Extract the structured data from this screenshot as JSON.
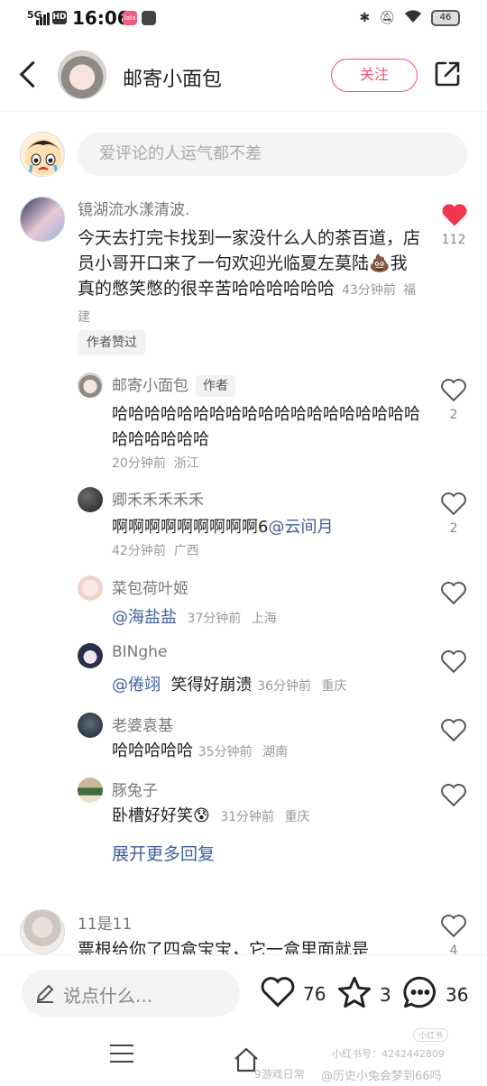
{
  "status_bar": {
    "network": "5G",
    "time": "16:06",
    "battery": "46"
  },
  "header": {
    "title": "邮寄小面包",
    "follow_label": "关注"
  },
  "comment_input": {
    "placeholder": "爱评论的人运气都不差"
  },
  "main_comment": {
    "user": "镜湖流水漾清波.",
    "text": "今天去打完卡找到一家没什么人的茶百道，店员小哥开口来了一句欢迎光临夏左莫陆💩我真的憋笑憋的很辛苦哈哈哈哈哈哈",
    "time": "43分钟前",
    "location": "福建",
    "badge": "作者赞过",
    "likes": "112",
    "like_color": "#f2364f"
  },
  "replies": [
    {
      "user": "邮寄小面包",
      "tag": "作者",
      "text": "哈哈哈哈哈哈哈哈哈哈哈哈哈哈哈哈哈哈哈哈哈哈哈哈哈",
      "time": "20分钟前",
      "location": "浙江",
      "likes": "2"
    },
    {
      "user": "卿禾禾禾禾禾",
      "text_pre": "啊啊啊啊啊啊啊啊啊6",
      "mention": "@云间月",
      "time": "42分钟前",
      "location": "广西",
      "likes": "2"
    },
    {
      "user": "菜包荷叶姬",
      "mention": "@海盐盐",
      "time": "37分钟前",
      "location": "上海"
    },
    {
      "user": "BINghe",
      "mention": "@倦翊",
      "text": "笑得好崩溃",
      "time": "36分钟前",
      "location": "重庆"
    },
    {
      "user": "老婆袁基",
      "text": "哈哈哈哈哈",
      "time": "35分钟前",
      "location": "湖南"
    },
    {
      "user": "豚兔子",
      "text": "卧槽好好笑😰",
      "time": "31分钟前",
      "location": "重庆"
    }
  ],
  "expand_label": "展开更多回复",
  "partial_comment": {
    "user": "11是11",
    "text": "票根给你了四盒宝宝，它一盒里面就是",
    "likes": "4"
  },
  "bottom_bar": {
    "input_label": "说点什么...",
    "likes": "76",
    "stars": "3",
    "comments": "36"
  },
  "watermark": {
    "line1": "小红书",
    "line2": "小红书号：4242442809",
    "line3": "@历史小兔会梦到66吗",
    "line4": "9游戏日常"
  }
}
